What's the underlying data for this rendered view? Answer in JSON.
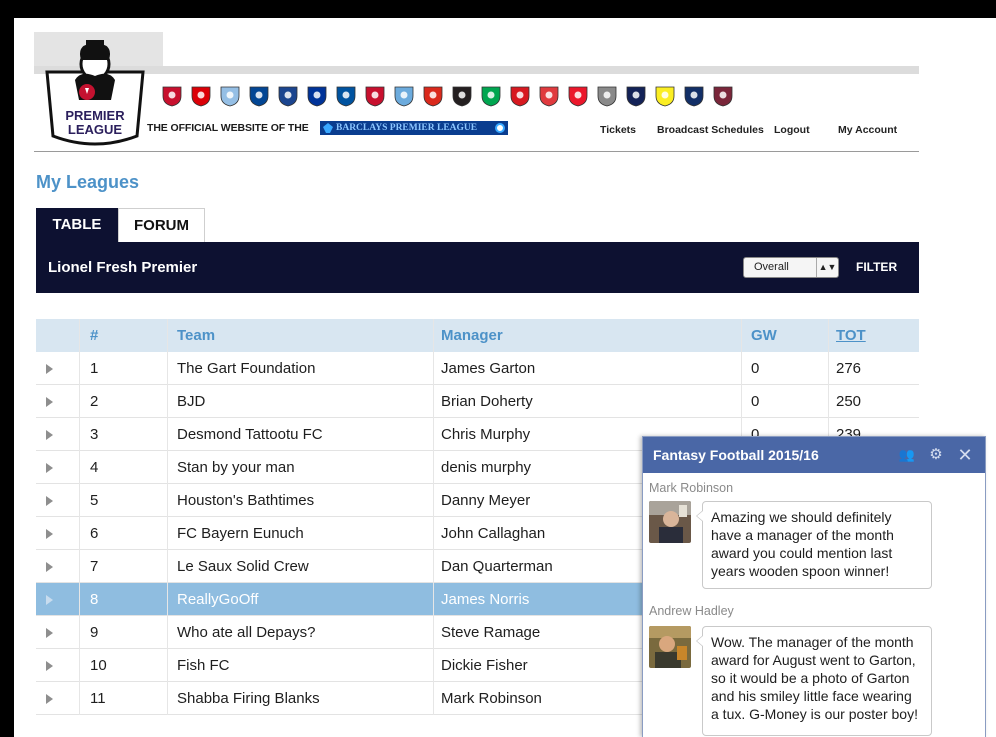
{
  "header": {
    "logo_text": [
      "PREMIER",
      "LEAGUE"
    ],
    "official_text": "THE OFFICIAL WEBSITE OF THE",
    "barclays_text": "BARCLAYS PREMIER LEAGUE",
    "links": [
      "Tickets",
      "Broadcast Schedules",
      "Logout",
      "My Account"
    ],
    "club_crests": [
      {
        "name": "bournemouth-crest",
        "color": "#c8102e"
      },
      {
        "name": "arsenal-crest",
        "color": "#db0007"
      },
      {
        "name": "aston-villa-crest",
        "color": "#95bfe5"
      },
      {
        "name": "chelsea-crest",
        "color": "#034694"
      },
      {
        "name": "crystal-palace-crest",
        "color": "#1b458f"
      },
      {
        "name": "everton-crest",
        "color": "#003399"
      },
      {
        "name": "leicester-crest",
        "color": "#0053a0"
      },
      {
        "name": "liverpool-crest",
        "color": "#c8102e"
      },
      {
        "name": "man-city-crest",
        "color": "#6cabdd"
      },
      {
        "name": "man-united-crest",
        "color": "#da291c"
      },
      {
        "name": "newcastle-crest",
        "color": "#241f20"
      },
      {
        "name": "norwich-crest",
        "color": "#00a650"
      },
      {
        "name": "southampton-crest",
        "color": "#d71920"
      },
      {
        "name": "stoke-crest",
        "color": "#e03a3e"
      },
      {
        "name": "sunderland-crest",
        "color": "#eb172b"
      },
      {
        "name": "swansea-crest",
        "color": "#8a8a8a"
      },
      {
        "name": "tottenham-crest",
        "color": "#132257"
      },
      {
        "name": "watford-crest",
        "color": "#fbee23"
      },
      {
        "name": "west-brom-crest",
        "color": "#122f67"
      },
      {
        "name": "west-ham-crest",
        "color": "#7a263a"
      }
    ]
  },
  "page": {
    "title": "My Leagues",
    "tabs": [
      "TABLE",
      "FORUM"
    ],
    "league_name": "Lionel Fresh Premier",
    "select_value": "Overall",
    "filter_label": "FILTER"
  },
  "table": {
    "columns": [
      "#",
      "Team",
      "Manager",
      "GW",
      "TOT"
    ],
    "rows": [
      {
        "rank": "1",
        "team": "The Gart Foundation",
        "manager": "James Garton",
        "gw": "0",
        "tot": "276"
      },
      {
        "rank": "2",
        "team": "BJD",
        "manager": "Brian Doherty",
        "gw": "0",
        "tot": "250"
      },
      {
        "rank": "3",
        "team": "Desmond Tattootu FC",
        "manager": "Chris Murphy",
        "gw": "0",
        "tot": "239"
      },
      {
        "rank": "4",
        "team": "Stan by your man",
        "manager": "denis murphy",
        "gw": "",
        "tot": ""
      },
      {
        "rank": "5",
        "team": "Houston's Bathtimes",
        "manager": "Danny Meyer",
        "gw": "",
        "tot": ""
      },
      {
        "rank": "6",
        "team": "FC Bayern Eunuch",
        "manager": "John Callaghan",
        "gw": "",
        "tot": ""
      },
      {
        "rank": "7",
        "team": "Le Saux Solid Crew",
        "manager": "Dan Quarterman",
        "gw": "",
        "tot": ""
      },
      {
        "rank": "8",
        "team": "ReallyGoOff",
        "manager": "James Norris",
        "gw": "",
        "tot": ""
      },
      {
        "rank": "9",
        "team": "Who ate all Depays?",
        "manager": "Steve Ramage",
        "gw": "",
        "tot": ""
      },
      {
        "rank": "10",
        "team": "Fish FC",
        "manager": "Dickie Fisher",
        "gw": "",
        "tot": ""
      },
      {
        "rank": "11",
        "team": "Shabba Firing Blanks",
        "manager": "Mark Robinson",
        "gw": "",
        "tot": ""
      }
    ],
    "highlighted_row_index": 7
  },
  "chat": {
    "title": "Fantasy Football 2015/16",
    "messages": [
      {
        "sender": "Mark Robinson",
        "text": "Amazing we should definitely have a manager of the month award you could mention last years wooden spoon winner!"
      },
      {
        "sender": "Andrew Hadley",
        "text": "Wow. The manager of the month award for August went to Garton, so it would be a photo of Garton and his smiley little face wearing a tux. G-Money is our poster boy!"
      }
    ]
  }
}
